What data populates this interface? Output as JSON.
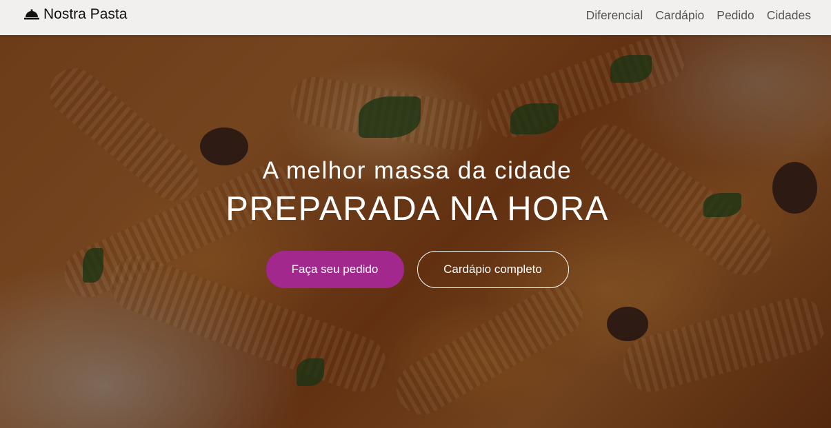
{
  "navbar": {
    "brand": "Nostra Pasta",
    "brand_icon": "service-bell-icon",
    "links": [
      "Diferencial",
      "Cardápio",
      "Pedido",
      "Cidades"
    ]
  },
  "hero": {
    "subtitle": "A melhor massa da cidade",
    "title": "PREPARADA NA HORA",
    "primary_button": "Faça seu pedido",
    "secondary_button": "Cardápio completo"
  },
  "colors": {
    "accent": "#a2288e",
    "navbar_bg": "#f8f8f8"
  }
}
